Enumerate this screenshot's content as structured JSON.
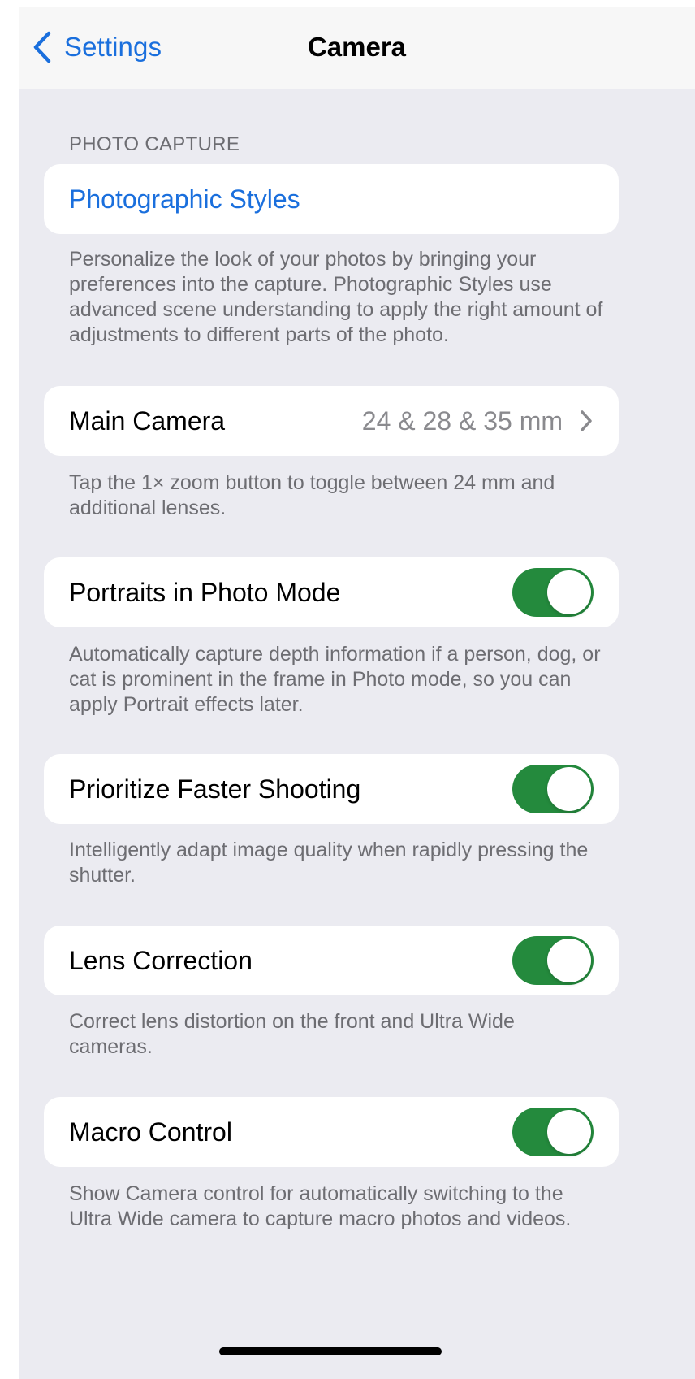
{
  "nav": {
    "back_label": "Settings",
    "title": "Camera"
  },
  "section": {
    "header": "PHOTO CAPTURE"
  },
  "photographic_styles": {
    "label": "Photographic Styles",
    "footer": "Personalize the look of your photos by bringing your preferences into the capture. Photographic Styles use advanced scene understanding to apply the right amount of adjustments to different parts of the photo."
  },
  "main_camera": {
    "label": "Main Camera",
    "value": "24 & 28 & 35 mm",
    "footer": "Tap the 1× zoom button to toggle between 24 mm and additional lenses."
  },
  "portraits": {
    "label": "Portraits in Photo Mode",
    "enabled": true,
    "footer": "Automatically capture depth information if a person, dog, or cat is prominent in the frame in Photo mode, so you can apply Portrait effects later."
  },
  "faster_shooting": {
    "label": "Prioritize Faster Shooting",
    "enabled": true,
    "footer": "Intelligently adapt image quality when rapidly pressing the shutter."
  },
  "lens_correction": {
    "label": "Lens Correction",
    "enabled": true,
    "footer": "Correct lens distortion on the front and Ultra Wide cameras."
  },
  "macro_control": {
    "label": "Macro Control",
    "enabled": true,
    "footer": "Show Camera control for automatically switching to the Ultra Wide camera to capture macro photos and videos."
  },
  "colors": {
    "accent": "#1a6fdd",
    "toggle_on": "#248a3d",
    "background": "#ebebf1"
  },
  "icons": {
    "back": "chevron-left-icon",
    "disclosure": "chevron-right-icon"
  }
}
